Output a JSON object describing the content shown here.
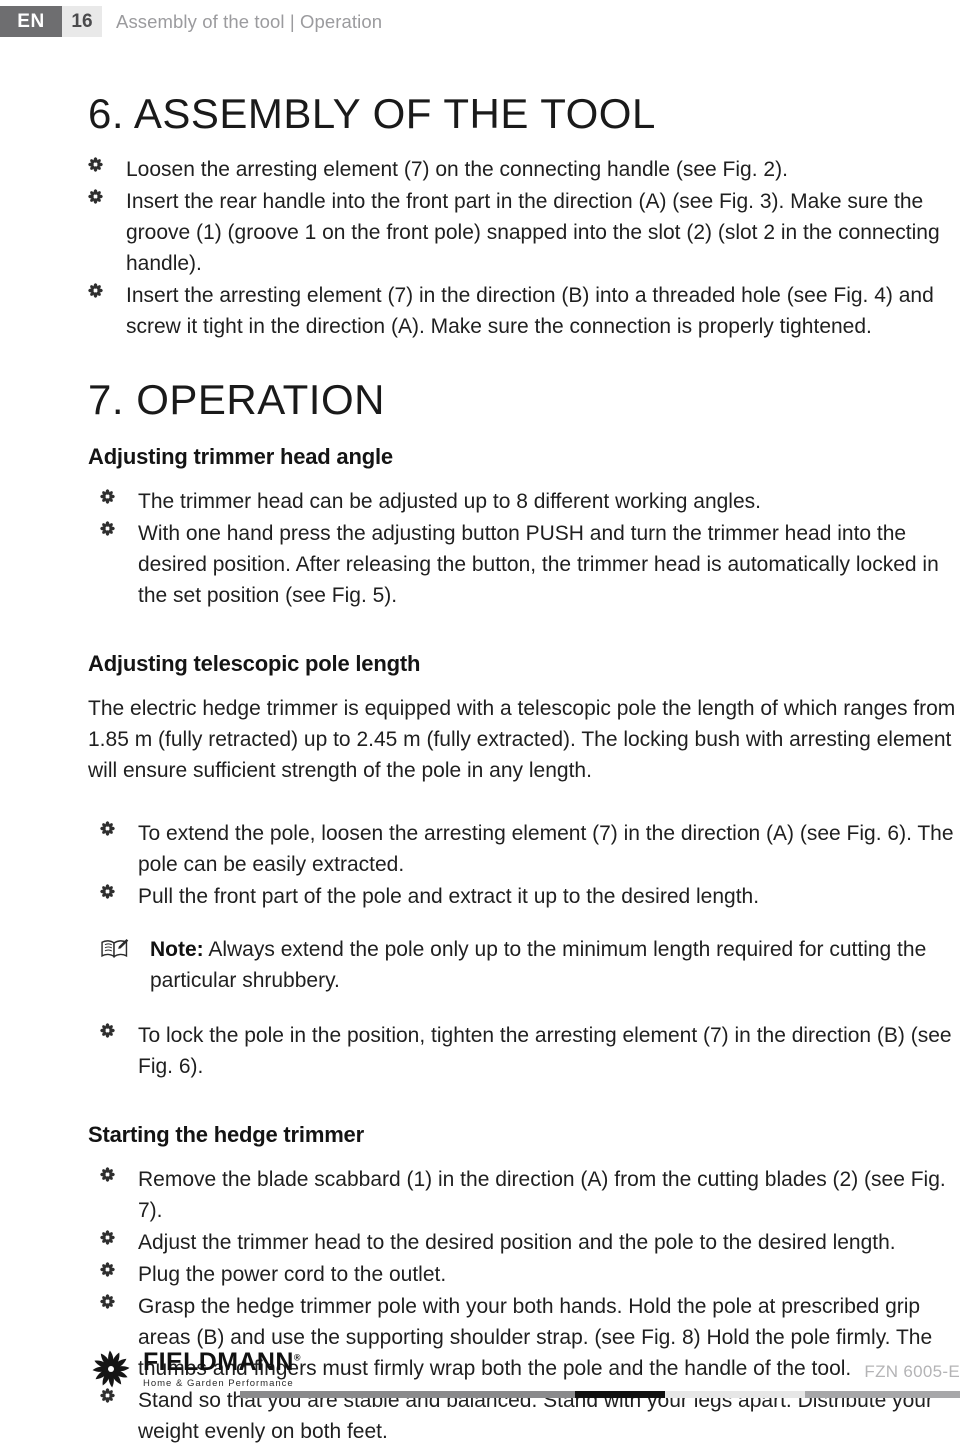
{
  "header": {
    "lang": "EN",
    "page_number": "16",
    "title": "Assembly of the tool | Operation"
  },
  "sections": {
    "assembly": {
      "heading": "6. ASSEMBLY OF THE TOOL",
      "bullets": [
        "Loosen the arresting element (7) on the connecting handle (see Fig. 2).",
        "Insert the rear handle into the front part in the direction (A) (see Fig. 3). Make sure the groove (1) (groove 1 on the front pole) snapped into the slot (2) (slot 2 in the connecting handle).",
        "Insert the arresting element (7) in the direction (B) into a threaded hole (see Fig. 4) and screw it tight in the direction (A). Make sure the connection is properly tightened."
      ]
    },
    "operation": {
      "heading": "7. OPERATION",
      "head_angle": {
        "subheading": "Adjusting trimmer head angle",
        "bullets": [
          "The trimmer head can be adjusted up to 8 different working angles.",
          "With one hand press the adjusting button PUSH and turn the trimmer head into the desired position. After releasing the button, the trimmer head is automatically locked in the set position (see Fig. 5)."
        ]
      },
      "pole_length": {
        "subheading": "Adjusting telescopic pole length",
        "paragraph": "The electric hedge trimmer is equipped with a telescopic pole the length of which ranges from 1.85 m (fully retracted) up to 2.45 m (fully extracted). The locking bush with arresting element will ensure sufficient strength of the pole in any length.",
        "bullets_before_note": [
          "To extend the pole, loosen the arresting element (7) in the direction (A) (see Fig. 6). The pole can be easily extracted.",
          "Pull the front part of the pole and extract it up to the desired length."
        ],
        "note_label": "Note:",
        "note_text": " Always extend the pole only up to the minimum length required for cutting the particular shrubbery.",
        "bullets_after_note": [
          "To lock the pole in the position, tighten the arresting element (7) in the direction (B) (see Fig. 6)."
        ]
      },
      "starting": {
        "subheading": "Starting the hedge trimmer",
        "bullets": [
          "Remove the blade scabbard (1) in the direction (A) from the cutting blades (2) (see Fig. 7).",
          "Adjust the trimmer head to the desired position and the pole to the desired length.",
          "Plug the power cord to the outlet.",
          "Grasp the hedge trimmer pole with your both hands. Hold the pole at prescribed grip areas (B) and use the supporting shoulder strap. (see Fig. 8) Hold the pole firmly. The thumbs and fingers must firmly wrap both the pole and the handle of the tool.",
          "Stand so that you are stable and balanced. Stand with your legs apart. Distribute your weight evenly on both feet."
        ]
      }
    }
  },
  "footer": {
    "brand_name": "FIELDMANN",
    "brand_reg": "®",
    "tagline": "Home & Garden Performance",
    "model": "FZN 6005-E"
  },
  "colors": {
    "header_lang_bg": "#6e6e70",
    "header_page_bg": "#e9e9e9",
    "header_title_text": "#9b9b9e",
    "body_text": "#1f1f1f",
    "model_text": "#b4b4b6",
    "bar_gray": "#8a8a8c",
    "bar_black": "#101010",
    "bar_light": "#e6e6e6",
    "bar_mid": "#a7a7a9"
  }
}
